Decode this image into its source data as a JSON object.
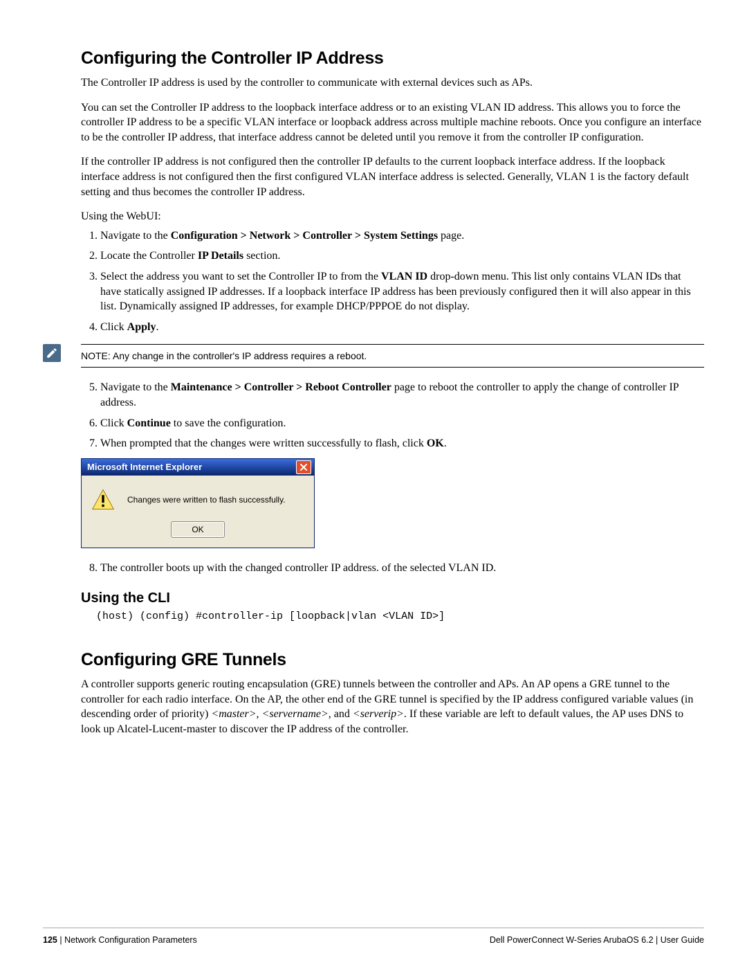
{
  "section1": {
    "title": "Configuring the Controller IP Address",
    "para1": "The Controller IP address is used by the controller to communicate with external devices such as APs.",
    "para2": "You can set the Controller IP address to the loopback interface address or to an existing VLAN ID address. This allows you to force the controller IP address to be a specific VLAN interface or loopback address across multiple machine reboots. Once you configure an interface to be the controller IP address, that interface address cannot be deleted until you remove it from the controller IP configuration.",
    "para3": "If the controller IP address is not configured then the controller IP defaults to the current loopback interface address. If the loopback interface address is not configured then the first configured VLAN interface address is selected. Generally, VLAN 1 is the factory default setting and thus becomes the controller IP address.",
    "using_webui": "Using the WebUI:",
    "step1_pre": "Navigate to the ",
    "step1_bold": "Configuration > Network > Controller > System Settings",
    "step1_post": " page.",
    "step2_pre": "Locate the Controller ",
    "step2_bold": "IP Details",
    "step2_post": " section.",
    "step3_pre": "Select the address you want to set the Controller IP to from the ",
    "step3_bold": "VLAN ID",
    "step3_post": " drop-down menu. This list only contains VLAN IDs that have statically assigned IP addresses. If a loopback interface IP address has been previously configured then it will also appear in this list. Dynamically assigned IP addresses, for example DHCP/PPPOE do not display.",
    "step4_pre": "Click ",
    "step4_bold": "Apply",
    "step4_post": ".",
    "note": "NOTE: Any change in the controller's IP address requires a reboot.",
    "step5_pre": "Navigate to the ",
    "step5_bold": "Maintenance > Controller > Reboot Controller",
    "step5_post": " page to reboot the controller to apply the change of controller IP address.",
    "step6_pre": "Click ",
    "step6_bold": "Continue",
    "step6_post": " to save the configuration.",
    "step7_pre": "When prompted that the changes were written successfully to flash, click ",
    "step7_bold": "OK",
    "step7_post": ".",
    "step8": "The controller boots up with the changed controller IP address. of the selected VLAN ID."
  },
  "dialog": {
    "title": "Microsoft Internet Explorer",
    "message": "Changes were written to flash successfully.",
    "ok": "OK"
  },
  "cli": {
    "title": "Using the CLI",
    "command": "(host) (config) #controller-ip [loopback|vlan <VLAN ID>]"
  },
  "section2": {
    "title": "Configuring GRE Tunnels",
    "para_pre": "A controller supports generic routing encapsulation (GRE) tunnels between the controller and APs. An AP opens a GRE tunnel to the controller for each radio interface. On the AP, the other end of the GRE tunnel is specified by the IP address configured variable values (in descending order of priority) ",
    "v1": "<master>",
    "c1": ", ",
    "v2": "<servername>",
    "c2": ", and ",
    "v3": "<serverip>",
    "para_post": ". If these variable are left to default values, the AP uses DNS to look up Alcatel-Lucent-master to discover the IP address of the controller."
  },
  "footer": {
    "page": "125",
    "sep": " | ",
    "chapter": "Network Configuration Parameters",
    "right": "Dell PowerConnect W-Series ArubaOS 6.2  |  User Guide"
  }
}
